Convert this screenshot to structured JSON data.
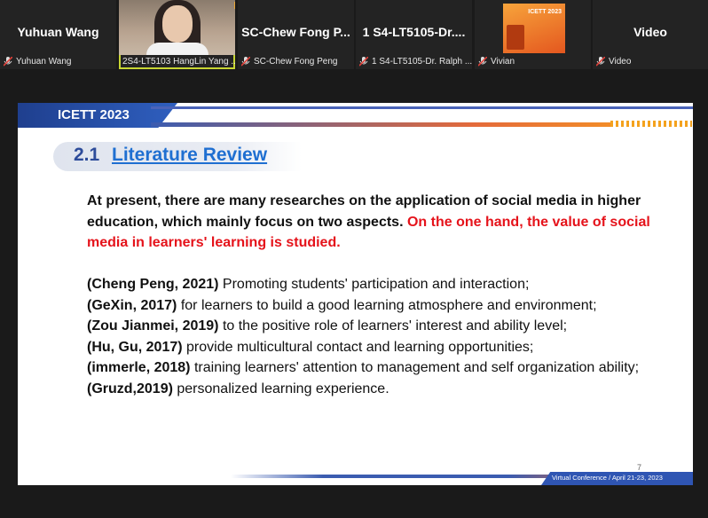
{
  "participants": [
    {
      "name_large": "Yuhuan Wang",
      "label": "Yuhuan Wang",
      "mic_muted": true
    },
    {
      "name_large": "",
      "label": "2S4-LT5103 HangLin Yang ...",
      "mic_muted": false,
      "active_speaker": true
    },
    {
      "name_large": "SC-Chew Fong P...",
      "label": "SC-Chew Fong Peng",
      "mic_muted": true
    },
    {
      "name_large": "1 S4-LT5105-Dr....",
      "label": "1 S4-LT5105-Dr. Ralph ...",
      "mic_muted": true
    },
    {
      "name_large": "",
      "label": "Vivian",
      "mic_muted": true
    },
    {
      "name_large": "Video",
      "label": "Video",
      "mic_muted": true
    }
  ],
  "slide": {
    "header_brand": "ICETT 2023",
    "section_number": "2.1",
    "section_title": "Literature Review",
    "intro_black": "At present, there are many researches on the application of social media in higher education, which mainly focus on two aspects.",
    "intro_red": "On the one hand, the value of social media in learners' learning is studied.",
    "references": [
      {
        "cite": "(Cheng Peng, 2021)",
        "text": " Promoting students' participation and interaction;"
      },
      {
        "cite": "(GeXin, 2017)",
        "text": " for learners to build a good learning atmosphere and environment;"
      },
      {
        "cite": "(Zou Jianmei, 2019)",
        "text": " to the positive role of learners' interest and ability level;"
      },
      {
        "cite": "(Hu, Gu, 2017)",
        "text": " provide multicultural contact and learning opportunities;"
      },
      {
        "cite": "(immerle, 2018)",
        "text": " training learners' attention to management and self organization ability;"
      },
      {
        "cite": "(Gruzd,2019)",
        "text": "  personalized learning experience."
      }
    ],
    "page_number": "7",
    "footer_text": "Virtual Conference / April 21-23, 2023"
  },
  "poster": {
    "title": "ICETT 2023"
  },
  "colors": {
    "accent_red": "#e5131b",
    "brand_blue": "#2f55b3",
    "title_blue": "#1f6fd1",
    "active_speaker": "#c8d633"
  }
}
